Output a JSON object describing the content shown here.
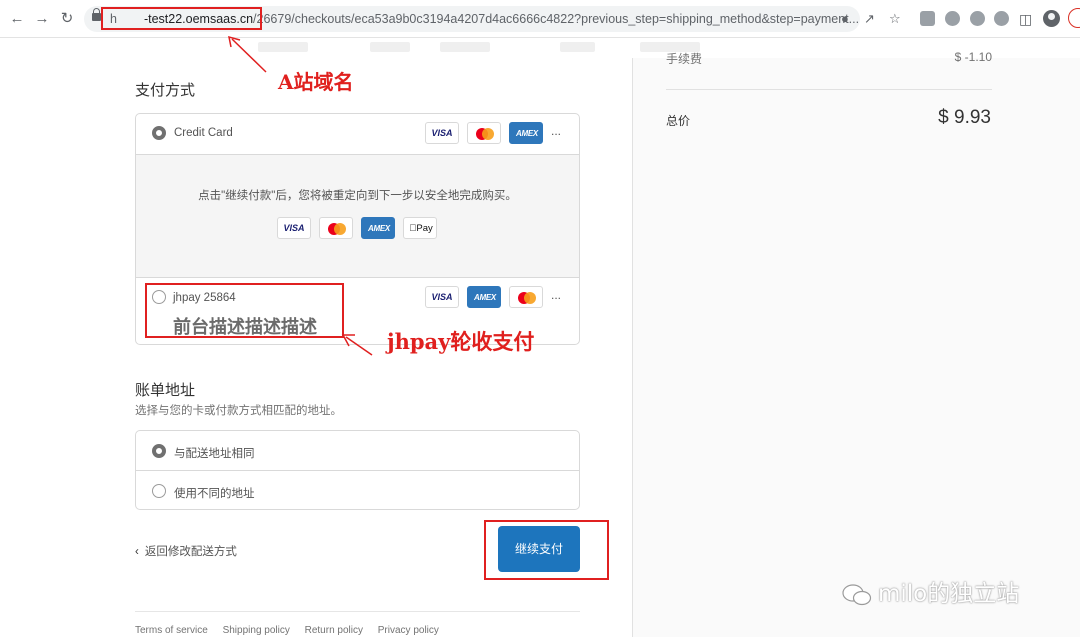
{
  "browser": {
    "url_prefix": "h",
    "url_domain": "-test22.oemsaas.cn",
    "url_path": "/26679/checkouts/eca53a9b0c3194a4207d4ac6666c4822?previous_step=shipping_method&step=payment..."
  },
  "summary": {
    "fee_label": "手续费",
    "fee_value": "$ -1.10",
    "total_label": "总价",
    "total_value": "$ 9.93"
  },
  "payment": {
    "title": "支付方式",
    "credit_card_label": "Credit Card",
    "redirect_message": "点击\"继续付款\"后，您将被重定向到下一步以安全地完成购买。",
    "jhpay_label": "jhpay 25864",
    "jhpay_description": "前台描述描述描述",
    "more": "..."
  },
  "billing": {
    "title": "账单地址",
    "subtitle": "选择与您的卡或付款方式相匹配的地址。",
    "option_same": "与配送地址相同",
    "option_different": "使用不同的地址"
  },
  "actions": {
    "back_label": "返回修改配送方式",
    "continue_label": "继续支付"
  },
  "footer": {
    "terms": "Terms of service",
    "shipping": "Shipping policy",
    "return": "Return policy",
    "privacy": "Privacy policy"
  },
  "annotations": {
    "domain_note": "A站域名",
    "jhpay_note": "jhpay轮收支付"
  },
  "watermark": "milo的独立站",
  "colors": {
    "annotation_red": "#e02020",
    "button_blue": "#1d75bd"
  }
}
